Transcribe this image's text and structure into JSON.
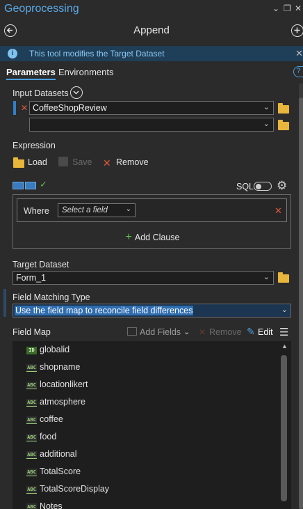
{
  "window": {
    "title": "Geoprocessing",
    "controls": {
      "menu": "⌄",
      "restore": "❐",
      "close": "✕"
    }
  },
  "tool": {
    "name": "Append",
    "back_icon": "back-arrow-icon",
    "add_icon": "add-icon"
  },
  "info": {
    "message": "This tool modifies the Target Dataset",
    "close": "✕"
  },
  "tabs": [
    {
      "label": "Parameters",
      "active": true
    },
    {
      "label": "Environments",
      "active": false
    }
  ],
  "help_label": "?",
  "input_datasets": {
    "label": "Input Datasets",
    "rows": [
      {
        "value": "CoffeeShopReview"
      },
      {
        "value": ""
      }
    ]
  },
  "expression": {
    "label": "Expression",
    "load_label": "Load",
    "save_label": "Save",
    "remove_label": "Remove",
    "sql_label": "SQL",
    "where_label": "Where",
    "select_field_placeholder": "Select a field",
    "add_clause_label": "Add Clause"
  },
  "target_dataset": {
    "label": "Target Dataset",
    "value": "Form_1"
  },
  "field_matching_type": {
    "label": "Field Matching Type",
    "value": "Use the field map to reconcile field differences"
  },
  "field_map": {
    "label": "Field Map",
    "add_fields_label": "Add Fields",
    "remove_label": "Remove",
    "edit_label": "Edit",
    "fields": [
      {
        "type": "ID",
        "name": "globalid"
      },
      {
        "type": "ABC",
        "name": "shopname"
      },
      {
        "type": "ABC",
        "name": "locationlikert"
      },
      {
        "type": "ABC",
        "name": "atmosphere"
      },
      {
        "type": "ABC",
        "name": "coffee"
      },
      {
        "type": "ABC",
        "name": "food"
      },
      {
        "type": "ABC",
        "name": "additional"
      },
      {
        "type": "ABC",
        "name": "TotalScore"
      },
      {
        "type": "ABC",
        "name": "TotalScoreDisplay"
      },
      {
        "type": "ABC",
        "name": "Notes"
      }
    ]
  },
  "colors": {
    "accent": "#4a9fe0",
    "title_blue": "#5aa9e6",
    "info_bg": "#1f3e57",
    "folder": "#e8b63a",
    "remove_red": "#e05a3a",
    "add_green": "#5fbf4a"
  }
}
